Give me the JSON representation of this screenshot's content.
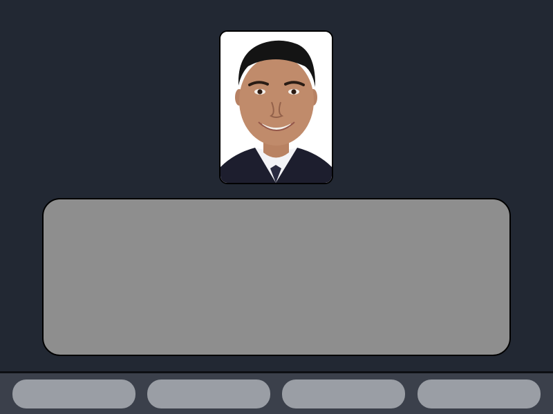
{
  "theme": {
    "background": "#222833",
    "panel": "#8e8e8e",
    "bottom_bar": "#3b404b",
    "button": "#9a9ea5",
    "border": "#000000"
  },
  "profile": {
    "photo": "profile-photo",
    "photo_background": "#ffffff"
  },
  "content_panel": {
    "text": ""
  },
  "bottom_bar": {
    "buttons": [
      {
        "label": ""
      },
      {
        "label": ""
      },
      {
        "label": ""
      },
      {
        "label": ""
      }
    ]
  }
}
